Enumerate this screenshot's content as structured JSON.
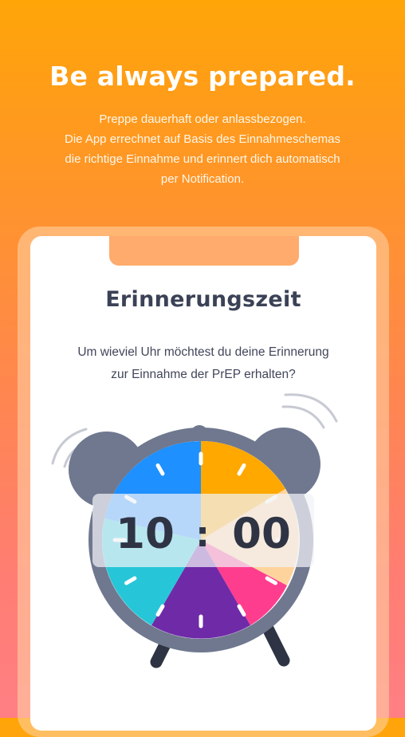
{
  "hero": {
    "title": "Be always prepared.",
    "description_lines": [
      "Preppe dauerhaft oder anlassbezogen.",
      "Die App errechnet auf Basis des Einnahmeschemas",
      "die richtige Einnahme und erinnert dich automatisch",
      "per Notification."
    ]
  },
  "screen": {
    "title": "Erinnerungszeit",
    "question_lines": [
      "Um wieviel Uhr möchtest du deine Erinnerung",
      "zur Einnahme der PrEP erhalten?"
    ]
  },
  "time": {
    "hours": "10",
    "separator": ":",
    "minutes": "00"
  },
  "colors": {
    "clock_frame": "#6f788f",
    "segment_orange": "#ffa800",
    "segment_peach": "#ffd49c",
    "segment_pink": "#ff3d8f",
    "segment_purple": "#6f2aa8",
    "segment_cyan": "#26c6d8",
    "segment_blue": "#1e90ff"
  }
}
